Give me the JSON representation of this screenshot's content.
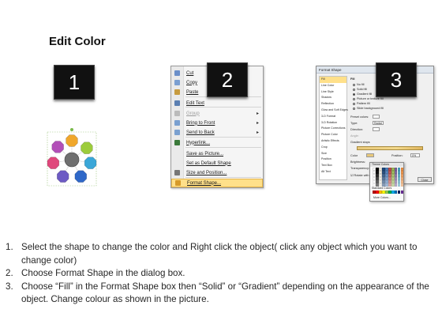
{
  "title": "Edit Color",
  "badges": [
    "1",
    "2",
    "3"
  ],
  "shapes": {
    "center_color": "#6f6f6f",
    "nodes": [
      {
        "name": "top",
        "color": "#f0a72b"
      },
      {
        "name": "top-right",
        "color": "#9ccc3b"
      },
      {
        "name": "right",
        "color": "#3aa7d8"
      },
      {
        "name": "bottom-right",
        "color": "#2f68c8"
      },
      {
        "name": "bottom-left",
        "color": "#6d5bc4"
      },
      {
        "name": "left",
        "color": "#e0487c"
      },
      {
        "name": "top-left",
        "color": "#b24fb8"
      }
    ]
  },
  "context_menu": {
    "items": [
      {
        "label": "Cut",
        "icon": "scissors-icon",
        "icon_color": "#6b8fc9"
      },
      {
        "label": "Copy",
        "icon": "copy-icon",
        "icon_color": "#7b9fd1"
      },
      {
        "label": "Paste",
        "icon": "paste-icon",
        "icon_color": "#c79b3f"
      },
      {
        "label": "Edit Text",
        "icon": "edit-text-icon",
        "icon_color": "#5b7fb2"
      },
      {
        "label": "Group",
        "icon": "group-icon",
        "icon_color": "#bbbbbb",
        "disabled": true,
        "submenu": true
      },
      {
        "label": "Bring to Front",
        "icon": "bring-front-icon",
        "icon_color": "#7aa0d0",
        "submenu": true
      },
      {
        "label": "Send to Back",
        "icon": "send-back-icon",
        "icon_color": "#7aa0d0",
        "submenu": true
      },
      {
        "label": "Hyperlink...",
        "icon": "hyperlink-icon",
        "icon_color": "#3b7a3b"
      },
      {
        "label": "Save as Picture...",
        "icon": "",
        "icon_color": ""
      },
      {
        "label": "Set as Default Shape",
        "icon": "",
        "icon_color": ""
      },
      {
        "label": "Size and Position...",
        "icon": "size-position-icon",
        "icon_color": "#777777"
      },
      {
        "label": "Format Shape...",
        "icon": "format-shape-icon",
        "icon_color": "#d69a2a",
        "highlighted": true
      }
    ]
  },
  "format_dialog": {
    "title": "Format Shape",
    "nav": [
      "Fill",
      "Line Color",
      "Line Style",
      "Shadow",
      "Reflection",
      "Glow and Soft Edges",
      "3-D Format",
      "3-D Rotation",
      "Picture Corrections",
      "Picture Color",
      "Artistic Effects",
      "Crop",
      "Size",
      "Position",
      "Text Box",
      "Alt Text"
    ],
    "section": "Fill",
    "options": [
      "No fill",
      "Solid fill",
      "Gradient fill",
      "Picture or texture fill",
      "Pattern fill",
      "Slide background fill"
    ],
    "labels": {
      "preset": "Preset colors:",
      "type": "Type:",
      "type_value": "Radial",
      "direction": "Direction:",
      "angle": "Angle:",
      "stops": "Gradient stops",
      "color": "Color",
      "position": "Position:",
      "position_value": "0%",
      "brightness": "Brightness:",
      "transparency": "Transparency:",
      "rotate": "Rotate with shape",
      "close": "Close"
    },
    "palette": {
      "theme_title": "Theme Colors",
      "standard_title": "Standard Colors",
      "more": "More Colors...",
      "theme_colors": [
        "#ffffff",
        "#000000",
        "#eeece1",
        "#1f497d",
        "#4f81bd",
        "#c0504d",
        "#9bbb59",
        "#8064a2",
        "#4bacc6",
        "#f79646"
      ],
      "standard_colors": [
        "#c00000",
        "#ff0000",
        "#ffc000",
        "#ffff00",
        "#92d050",
        "#00b050",
        "#00b0f0",
        "#0070c0",
        "#002060",
        "#7030a0"
      ]
    }
  },
  "instructions": [
    {
      "num": "1.",
      "text": "Select the shape to change the color and Right click the object( click any object which you want to change color)"
    },
    {
      "num": "2.",
      "text": "Choose Format Shape in the dialog box."
    },
    {
      "num": "3.",
      "text": "Choose “Fill” in the Format Shape box then “Solid” or “Gradient” depending on the appearance of the object. Change colour as shown in the picture."
    }
  ]
}
